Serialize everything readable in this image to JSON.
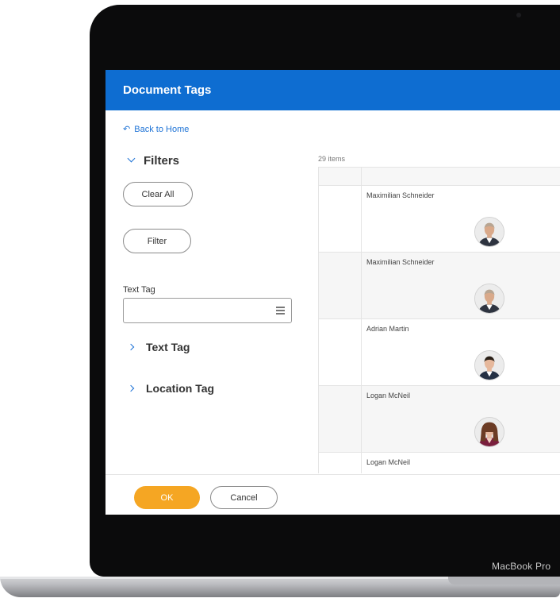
{
  "device": {
    "brand_label": "MacBook Pro"
  },
  "header": {
    "title": "Document Tags"
  },
  "nav": {
    "back_label": "Back to Home",
    "back_arrow": "↶"
  },
  "filters": {
    "title": "Filters",
    "clear_all_label": "Clear All",
    "filter_label": "Filter",
    "text_tag_field": {
      "label": "Text Tag",
      "value": ""
    },
    "sections": [
      {
        "label": "Text Tag",
        "expanded": false
      },
      {
        "label": "Location Tag",
        "expanded": false
      }
    ]
  },
  "results": {
    "count_label": "29 items",
    "rows": [
      {
        "name": "Maximilian Schneider",
        "avatar": "male-person-photo",
        "avatar_colors": {
          "skin": "#d9a98a",
          "hair": "#b8a592",
          "suit": "#2e3440",
          "shirt": "#ffffff"
        }
      },
      {
        "name": "Maximilian Schneider",
        "avatar": "male-person-photo",
        "avatar_colors": {
          "skin": "#d9a98a",
          "hair": "#b8a592",
          "suit": "#2e3440",
          "shirt": "#ffffff"
        }
      },
      {
        "name": "Adrian Martin",
        "avatar": "male-person-photo",
        "avatar_colors": {
          "skin": "#e6b89c",
          "hair": "#2a2018",
          "suit": "#243044",
          "shirt": "#ffffff"
        }
      },
      {
        "name": "Logan McNeil",
        "avatar": "female-person-photo",
        "avatar_colors": {
          "skin": "#e8b9a0",
          "hair": "#6b3b24",
          "suit": "#7a1f3d",
          "shirt": "#f2d1c4"
        }
      },
      {
        "name": "Logan McNeil",
        "avatar": "",
        "avatar_colors": null
      }
    ]
  },
  "footer": {
    "ok_label": "OK",
    "cancel_label": "Cancel"
  },
  "colors": {
    "header_blue": "#0e6dd1",
    "link_blue": "#1e73d6",
    "ok_orange": "#f5a623"
  }
}
